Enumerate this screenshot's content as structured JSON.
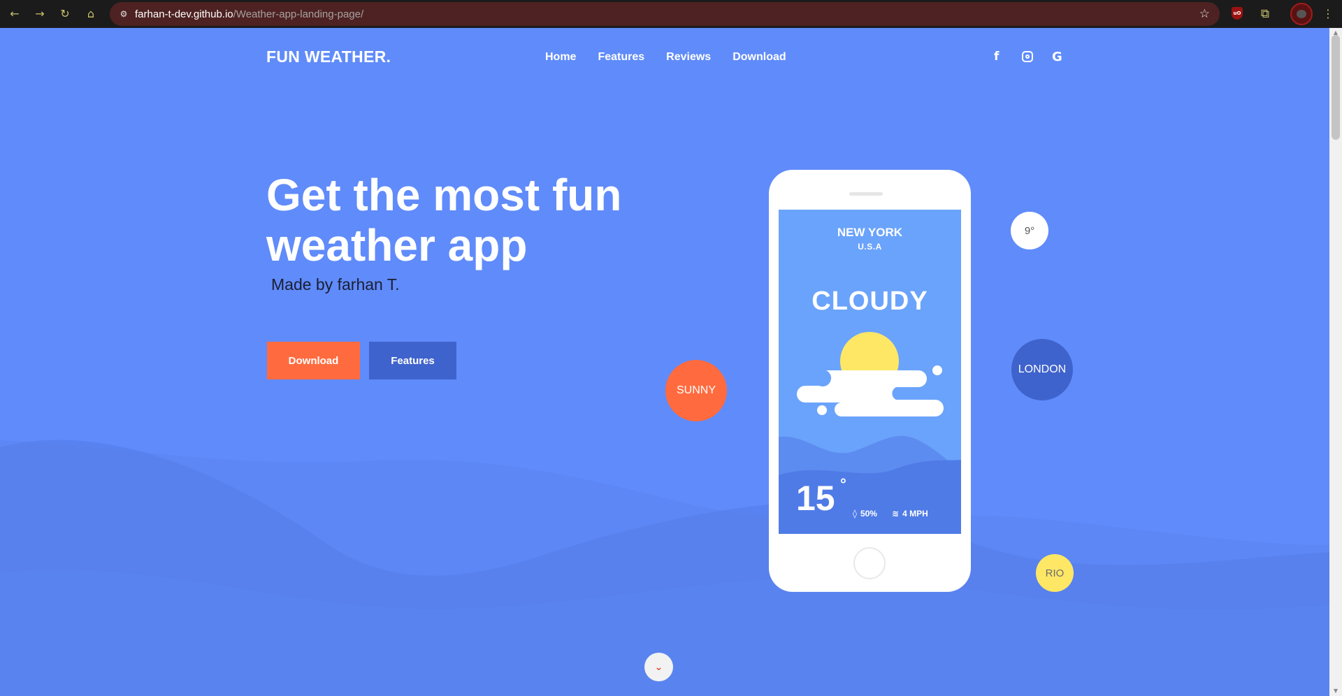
{
  "browser": {
    "url_host": "farhan-t-dev.github.io",
    "url_path": "/Weather-app-landing-page/",
    "icons": [
      "back-arrow-icon",
      "forward-arrow-icon",
      "reload-icon",
      "home-icon",
      "site-info-icon",
      "bookmark-star-icon",
      "ublock-icon",
      "extensions-puzzle-icon",
      "profile-avatar",
      "menu-dots-icon"
    ]
  },
  "header": {
    "logo": "FUN WEATHER.",
    "nav": [
      "Home",
      "Features",
      "Reviews",
      "Download"
    ],
    "social_icons": [
      "facebook-icon",
      "instagram-icon",
      "google-icon"
    ]
  },
  "hero": {
    "title": "Get the most fun weather app",
    "subtitle": "Made by farhan T.",
    "download_label": "Download",
    "features_label": "Features"
  },
  "phone": {
    "city": "NEW YORK",
    "country": "U.S.A",
    "condition": "CLOUDY",
    "temperature": "15",
    "degree_symbol": "°",
    "humidity": "50%",
    "wind": "4 MPH"
  },
  "bubbles": {
    "sunny": "SUNNY",
    "temp": "9°",
    "london": "LONDON",
    "rio": "RIO"
  },
  "colors": {
    "background": "#608bfa",
    "accent_orange": "#ff6b3f",
    "accent_blue": "#3f63cc",
    "accent_yellow": "#ffe766"
  }
}
